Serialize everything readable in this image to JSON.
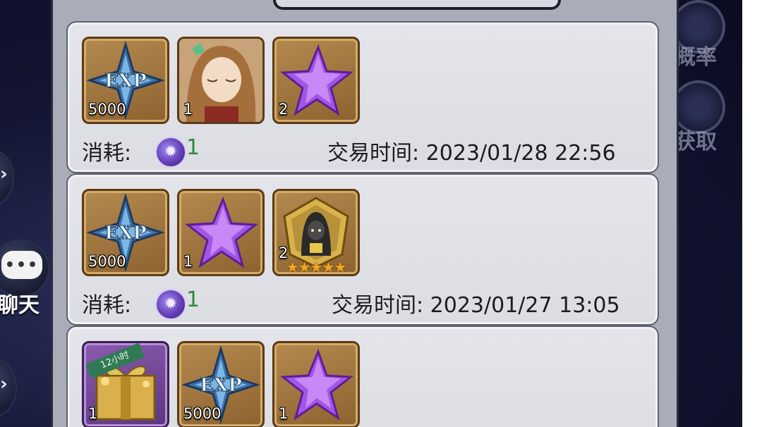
{
  "side": {
    "chat_bubble_text": "•••",
    "chat_label": "聊天",
    "right_label_1": "概率",
    "right_label_2": "获取"
  },
  "records": [
    {
      "items": [
        {
          "icon": "exp-icon",
          "qty": "5000"
        },
        {
          "icon": "character-portrait-icon",
          "qty": "1"
        },
        {
          "icon": "purple-star-crystal-icon",
          "qty": "2"
        }
      ],
      "cost_label": "消耗:",
      "cost_value": "1",
      "time_label": "交易时间:",
      "time_value": "2023/01/28 22:56"
    },
    {
      "items": [
        {
          "icon": "exp-icon",
          "qty": "5000"
        },
        {
          "icon": "purple-star-crystal-icon",
          "qty": "1"
        },
        {
          "icon": "hooded-hero-shard-icon",
          "qty": "2",
          "stars": "★★★★★"
        }
      ],
      "cost_label": "消耗:",
      "cost_value": "1",
      "time_label": "交易时间:",
      "time_value": "2023/01/27 13:05"
    },
    {
      "items": [
        {
          "icon": "gift-box-icon",
          "qty": "1",
          "badge": "12小时"
        },
        {
          "icon": "exp-icon",
          "qty": "5000"
        },
        {
          "icon": "purple-star-crystal-icon",
          "qty": "1"
        }
      ]
    }
  ]
}
